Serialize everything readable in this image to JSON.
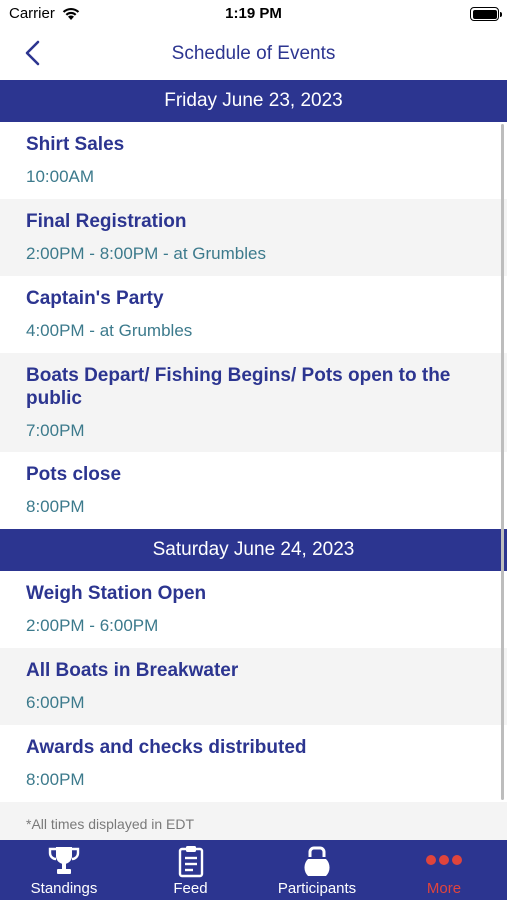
{
  "status_bar": {
    "carrier": "Carrier",
    "time": "1:19 PM"
  },
  "nav": {
    "title": "Schedule of Events"
  },
  "days": [
    {
      "date": "Friday June 23, 2023",
      "events": [
        {
          "title": "Shirt Sales",
          "time": "10:00AM"
        },
        {
          "title": "Final Registration",
          "time": "2:00PM - 8:00PM - at Grumbles"
        },
        {
          "title": "Captain's Party",
          "time": "4:00PM - at Grumbles"
        },
        {
          "title": "Boats Depart/ Fishing Begins/ Pots open to the public",
          "time": "7:00PM"
        },
        {
          "title": "Pots close",
          "time": "8:00PM"
        }
      ]
    },
    {
      "date": "Saturday June 24, 2023",
      "events": [
        {
          "title": "Weigh Station Open",
          "time": "2:00PM - 6:00PM"
        },
        {
          "title": "All Boats in Breakwater",
          "time": "6:00PM"
        },
        {
          "title": "Awards and checks distributed",
          "time": "8:00PM"
        }
      ]
    }
  ],
  "footnote": "*All times displayed in EDT",
  "tabs": [
    {
      "label": "Standings",
      "icon": "trophy-icon"
    },
    {
      "label": "Feed",
      "icon": "clipboard-icon"
    },
    {
      "label": "Participants",
      "icon": "kettlebell-icon"
    },
    {
      "label": "More",
      "icon": "more-dots-icon",
      "active": true
    }
  ],
  "colors": {
    "primary": "#2c3590",
    "time_text": "#3c7a8c",
    "active_tab": "#e0443c",
    "row_alt": "#f4f4f4"
  }
}
